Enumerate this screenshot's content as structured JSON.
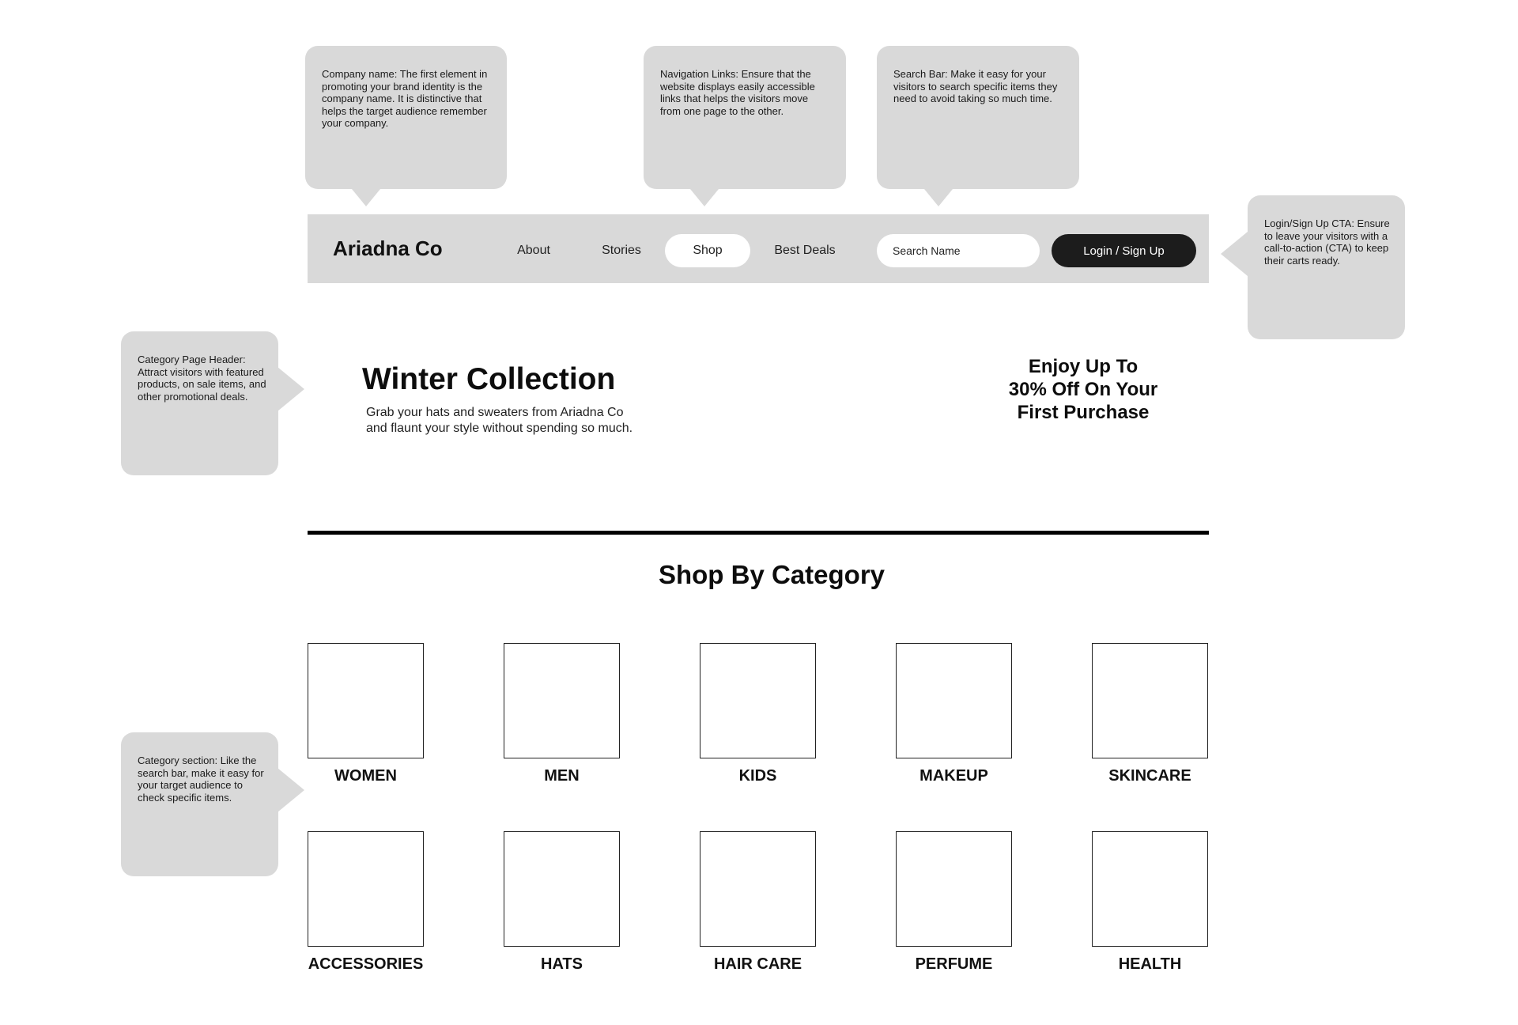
{
  "callouts": {
    "company": "Company name: The first element in promoting your brand identity is the company name. It is distinctive that helps the target audience remember your company.",
    "navigation": "Navigation Links: Ensure that the website displays easily accessible links that helps the visitors move from one page to the other.",
    "search": "Search Bar: Make it easy for your visitors to search specific items they need to avoid taking so much time.",
    "login": "Login/Sign Up CTA: Ensure to leave your visitors with a call-to-action (CTA) to keep their carts ready.",
    "header": "Category Page Header: Attract visitors with featured products, on sale items, and other promotional deals.",
    "category": "Category section: Like the search bar, make it easy for your target audience to check specific items."
  },
  "nav": {
    "brand": "Ariadna Co",
    "links": [
      {
        "label": "About",
        "active": false
      },
      {
        "label": "Stories",
        "active": false
      },
      {
        "label": "Shop",
        "active": true
      },
      {
        "label": "Best Deals",
        "active": false
      }
    ],
    "search_placeholder": "Search Name",
    "login_label": "Login / Sign Up"
  },
  "hero": {
    "title": "Winter Collection",
    "subtitle_lines": [
      "Grab your hats and sweaters from Ariadna Co",
      "and flaunt your style without spending so much."
    ],
    "promo_lines": [
      "Enjoy Up To",
      "30% Off On Your",
      "First Purchase"
    ]
  },
  "categories": {
    "title": "Shop By Category",
    "items": [
      "WOMEN",
      "MEN",
      "KIDS",
      "MAKEUP",
      "SKINCARE",
      "ACCESSORIES",
      "HATS",
      "HAIR CARE",
      "PERFUME",
      "HEALTH"
    ]
  },
  "colors": {
    "callout_bg": "#d9d9d9",
    "nav_bg": "#d9d9d9",
    "cta_bg": "#1c1c1c"
  }
}
